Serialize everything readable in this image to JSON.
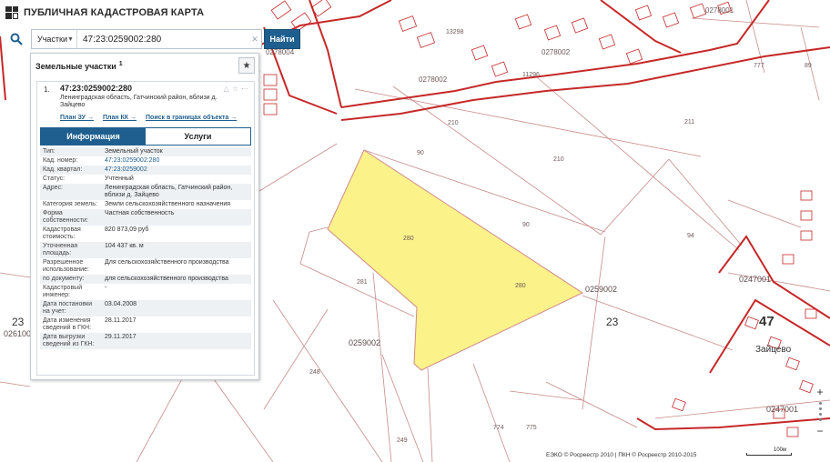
{
  "header": {
    "title": "ПУБЛИЧНАЯ КАДАСТРОВАЯ КАРТА"
  },
  "search": {
    "type_label": "Участки",
    "value": "47:23:0259002:280",
    "find_label": "Найти"
  },
  "panel": {
    "title": "Земельные участки",
    "count": "1",
    "item": {
      "index": "1.",
      "number": "47:23:0259002:280",
      "address": "Ленинградская область, Гатчинский район, вблизи д. Зайцево",
      "links": [
        "План ЗУ →",
        "План КК →",
        "Поиск в границах объекта →"
      ]
    },
    "tabs": [
      "Информация",
      "Услуги"
    ],
    "attributes": [
      {
        "key": "Тип:",
        "value": "Земельный участок"
      },
      {
        "key": "Кад. номер:",
        "value": "47:23:0259002:280"
      },
      {
        "key": "Кад. квартал:",
        "value": "47:23:0259002"
      },
      {
        "key": "Статус:",
        "value": "Учтенный"
      },
      {
        "key": "Адрес:",
        "value": "Ленинградская область, Гатчинский район, вблизи д. Зайцево"
      },
      {
        "key": "Категория земель:",
        "value": "Земли сельскохозяйственного назначения"
      },
      {
        "key": "Форма собственности:",
        "value": "Частная собственность"
      },
      {
        "key": "Кадастровая стоимость:",
        "value": "820 873,09 руб"
      },
      {
        "key": "Уточненная площадь:",
        "value": "104 437 кв. м"
      },
      {
        "key": "Разрешенное использование:",
        "value": "Для сельскохозяйственного производства"
      },
      {
        "key": "по документу:",
        "value": "для сельскохозяйственного производства"
      },
      {
        "key": "Кадастровый инженер:",
        "value": "-"
      },
      {
        "key": "Дата постановки на учет:",
        "value": "03.04.2008"
      },
      {
        "key": "Дата изменения сведений в ГКН:",
        "value": "28.11.2017"
      },
      {
        "key": "Дата выгрузки сведений из ГКН:",
        "value": "29.11.2017"
      }
    ]
  },
  "map": {
    "labels": {
      "q0278004": "0278004",
      "q0278002a": "0278002",
      "q0278002b": "0278002",
      "q0278001": "0278001",
      "q0259002a": "0259002",
      "q0259002b": "0259002",
      "q0247001a": "0247001",
      "q0247001b": "0247001",
      "q0261001": "026100",
      "district23a": "23",
      "district23b": "23",
      "region47": "47",
      "village": "Зайцево",
      "p210a": "210",
      "p210b": "210",
      "p90a": "90",
      "p90b": "90",
      "p280a": "280",
      "p280b": "280",
      "p211": "211",
      "p94": "94",
      "p777": "777",
      "p89": "89",
      "p281": "281",
      "p248": "248",
      "p249": "249",
      "p774": "774",
      "p775": "775",
      "p13298": "13298",
      "p11296": "11296",
      "p8006": "8006"
    },
    "colors": {
      "parcel_fill": "#fbf28a",
      "parcel_stroke": "#d18a8a",
      "boundary": "#c62828",
      "line": "#c88a8a"
    }
  },
  "footer": {
    "attribution": "ЕЭКО © Росреестр 2010 | ПКН © Росреестр 2010-2015",
    "scale_label": "100м"
  }
}
